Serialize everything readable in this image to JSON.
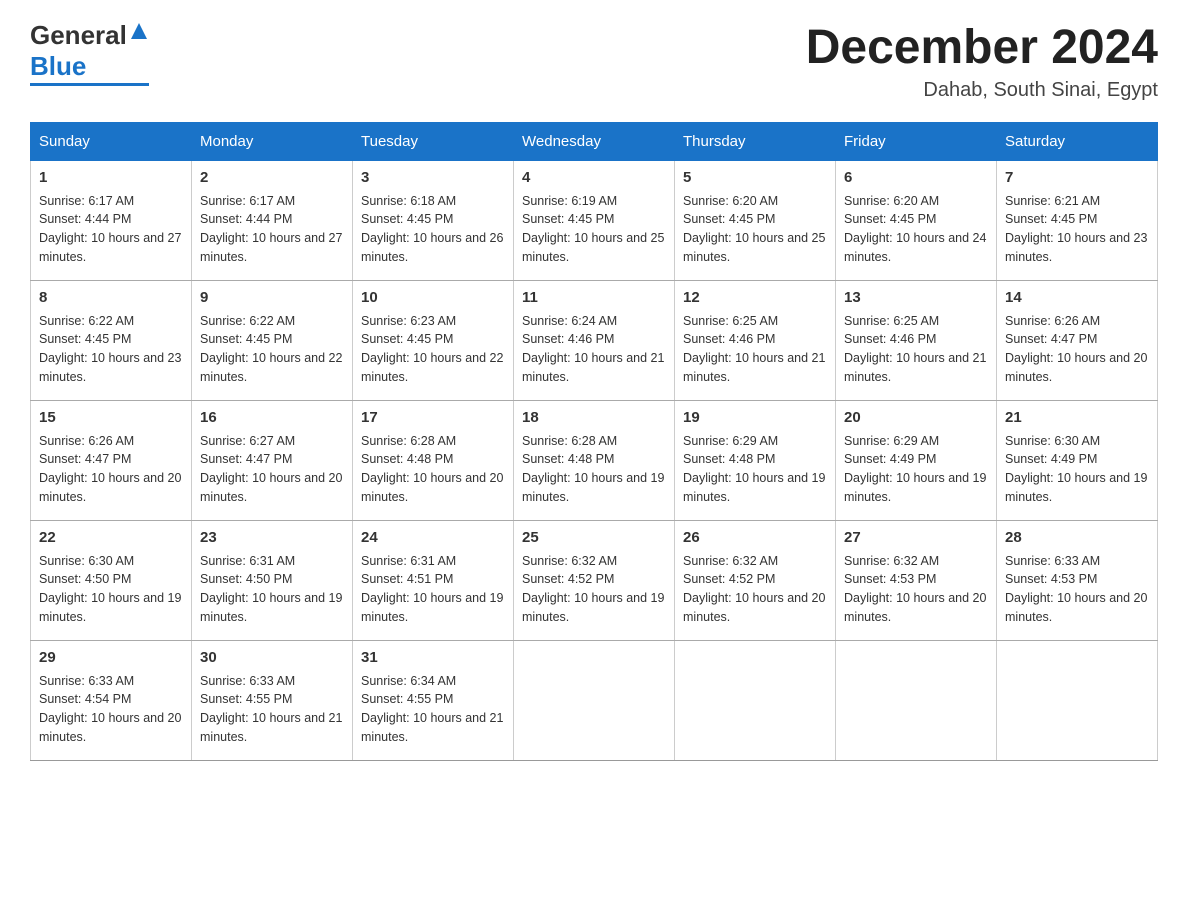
{
  "header": {
    "logo_general": "General",
    "logo_blue": "Blue",
    "month_title": "December 2024",
    "location": "Dahab, South Sinai, Egypt"
  },
  "days_of_week": [
    "Sunday",
    "Monday",
    "Tuesday",
    "Wednesday",
    "Thursday",
    "Friday",
    "Saturday"
  ],
  "weeks": [
    [
      {
        "day": "1",
        "sunrise": "Sunrise: 6:17 AM",
        "sunset": "Sunset: 4:44 PM",
        "daylight": "Daylight: 10 hours and 27 minutes."
      },
      {
        "day": "2",
        "sunrise": "Sunrise: 6:17 AM",
        "sunset": "Sunset: 4:44 PM",
        "daylight": "Daylight: 10 hours and 27 minutes."
      },
      {
        "day": "3",
        "sunrise": "Sunrise: 6:18 AM",
        "sunset": "Sunset: 4:45 PM",
        "daylight": "Daylight: 10 hours and 26 minutes."
      },
      {
        "day": "4",
        "sunrise": "Sunrise: 6:19 AM",
        "sunset": "Sunset: 4:45 PM",
        "daylight": "Daylight: 10 hours and 25 minutes."
      },
      {
        "day": "5",
        "sunrise": "Sunrise: 6:20 AM",
        "sunset": "Sunset: 4:45 PM",
        "daylight": "Daylight: 10 hours and 25 minutes."
      },
      {
        "day": "6",
        "sunrise": "Sunrise: 6:20 AM",
        "sunset": "Sunset: 4:45 PM",
        "daylight": "Daylight: 10 hours and 24 minutes."
      },
      {
        "day": "7",
        "sunrise": "Sunrise: 6:21 AM",
        "sunset": "Sunset: 4:45 PM",
        "daylight": "Daylight: 10 hours and 23 minutes."
      }
    ],
    [
      {
        "day": "8",
        "sunrise": "Sunrise: 6:22 AM",
        "sunset": "Sunset: 4:45 PM",
        "daylight": "Daylight: 10 hours and 23 minutes."
      },
      {
        "day": "9",
        "sunrise": "Sunrise: 6:22 AM",
        "sunset": "Sunset: 4:45 PM",
        "daylight": "Daylight: 10 hours and 22 minutes."
      },
      {
        "day": "10",
        "sunrise": "Sunrise: 6:23 AM",
        "sunset": "Sunset: 4:45 PM",
        "daylight": "Daylight: 10 hours and 22 minutes."
      },
      {
        "day": "11",
        "sunrise": "Sunrise: 6:24 AM",
        "sunset": "Sunset: 4:46 PM",
        "daylight": "Daylight: 10 hours and 21 minutes."
      },
      {
        "day": "12",
        "sunrise": "Sunrise: 6:25 AM",
        "sunset": "Sunset: 4:46 PM",
        "daylight": "Daylight: 10 hours and 21 minutes."
      },
      {
        "day": "13",
        "sunrise": "Sunrise: 6:25 AM",
        "sunset": "Sunset: 4:46 PM",
        "daylight": "Daylight: 10 hours and 21 minutes."
      },
      {
        "day": "14",
        "sunrise": "Sunrise: 6:26 AM",
        "sunset": "Sunset: 4:47 PM",
        "daylight": "Daylight: 10 hours and 20 minutes."
      }
    ],
    [
      {
        "day": "15",
        "sunrise": "Sunrise: 6:26 AM",
        "sunset": "Sunset: 4:47 PM",
        "daylight": "Daylight: 10 hours and 20 minutes."
      },
      {
        "day": "16",
        "sunrise": "Sunrise: 6:27 AM",
        "sunset": "Sunset: 4:47 PM",
        "daylight": "Daylight: 10 hours and 20 minutes."
      },
      {
        "day": "17",
        "sunrise": "Sunrise: 6:28 AM",
        "sunset": "Sunset: 4:48 PM",
        "daylight": "Daylight: 10 hours and 20 minutes."
      },
      {
        "day": "18",
        "sunrise": "Sunrise: 6:28 AM",
        "sunset": "Sunset: 4:48 PM",
        "daylight": "Daylight: 10 hours and 19 minutes."
      },
      {
        "day": "19",
        "sunrise": "Sunrise: 6:29 AM",
        "sunset": "Sunset: 4:48 PM",
        "daylight": "Daylight: 10 hours and 19 minutes."
      },
      {
        "day": "20",
        "sunrise": "Sunrise: 6:29 AM",
        "sunset": "Sunset: 4:49 PM",
        "daylight": "Daylight: 10 hours and 19 minutes."
      },
      {
        "day": "21",
        "sunrise": "Sunrise: 6:30 AM",
        "sunset": "Sunset: 4:49 PM",
        "daylight": "Daylight: 10 hours and 19 minutes."
      }
    ],
    [
      {
        "day": "22",
        "sunrise": "Sunrise: 6:30 AM",
        "sunset": "Sunset: 4:50 PM",
        "daylight": "Daylight: 10 hours and 19 minutes."
      },
      {
        "day": "23",
        "sunrise": "Sunrise: 6:31 AM",
        "sunset": "Sunset: 4:50 PM",
        "daylight": "Daylight: 10 hours and 19 minutes."
      },
      {
        "day": "24",
        "sunrise": "Sunrise: 6:31 AM",
        "sunset": "Sunset: 4:51 PM",
        "daylight": "Daylight: 10 hours and 19 minutes."
      },
      {
        "day": "25",
        "sunrise": "Sunrise: 6:32 AM",
        "sunset": "Sunset: 4:52 PM",
        "daylight": "Daylight: 10 hours and 19 minutes."
      },
      {
        "day": "26",
        "sunrise": "Sunrise: 6:32 AM",
        "sunset": "Sunset: 4:52 PM",
        "daylight": "Daylight: 10 hours and 20 minutes."
      },
      {
        "day": "27",
        "sunrise": "Sunrise: 6:32 AM",
        "sunset": "Sunset: 4:53 PM",
        "daylight": "Daylight: 10 hours and 20 minutes."
      },
      {
        "day": "28",
        "sunrise": "Sunrise: 6:33 AM",
        "sunset": "Sunset: 4:53 PM",
        "daylight": "Daylight: 10 hours and 20 minutes."
      }
    ],
    [
      {
        "day": "29",
        "sunrise": "Sunrise: 6:33 AM",
        "sunset": "Sunset: 4:54 PM",
        "daylight": "Daylight: 10 hours and 20 minutes."
      },
      {
        "day": "30",
        "sunrise": "Sunrise: 6:33 AM",
        "sunset": "Sunset: 4:55 PM",
        "daylight": "Daylight: 10 hours and 21 minutes."
      },
      {
        "day": "31",
        "sunrise": "Sunrise: 6:34 AM",
        "sunset": "Sunset: 4:55 PM",
        "daylight": "Daylight: 10 hours and 21 minutes."
      },
      null,
      null,
      null,
      null
    ]
  ]
}
